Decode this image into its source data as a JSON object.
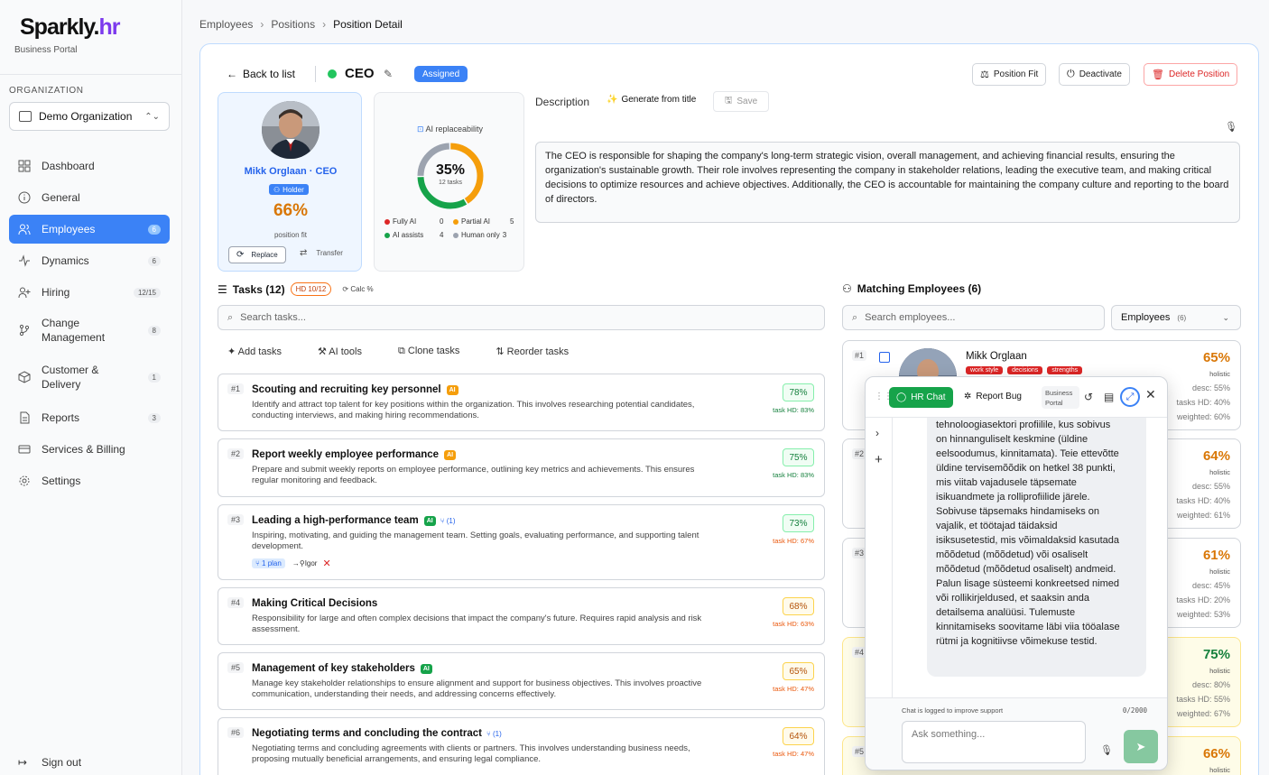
{
  "sidebar": {
    "logo_main": "Sparkly.",
    "logo_accent": "hr",
    "portal": "Business Portal",
    "org_label": "ORGANIZATION",
    "org_value": "Demo Organization",
    "items": [
      {
        "label": "Dashboard",
        "badge": "",
        "icon": "grid-icon"
      },
      {
        "label": "General",
        "badge": "",
        "icon": "info-icon"
      },
      {
        "label": "Employees",
        "badge": "6",
        "icon": "users-icon"
      },
      {
        "label": "Dynamics",
        "badge": "6",
        "icon": "activity-icon"
      },
      {
        "label": "Hiring",
        "badge": "12/15",
        "icon": "user-plus-icon"
      },
      {
        "label": "Change Management",
        "badge": "8",
        "icon": "git-branch-icon"
      },
      {
        "label": "Customer & Delivery",
        "badge": "1",
        "icon": "package-icon"
      },
      {
        "label": "Reports",
        "badge": "3",
        "icon": "document-icon"
      },
      {
        "label": "Services & Billing",
        "badge": "",
        "icon": "card-icon"
      },
      {
        "label": "Settings",
        "badge": "",
        "icon": "gear-icon"
      }
    ],
    "signout": "Sign out"
  },
  "breadcrumb": [
    "Employees",
    "Positions",
    "Position Detail"
  ],
  "header": {
    "back": "Back to list",
    "title": "CEO",
    "status": "Assigned",
    "btn_fit": "Position Fit",
    "btn_deactivate": "Deactivate",
    "btn_delete": "Delete Position"
  },
  "holder": {
    "name": "Mikk Orglaan · CEO",
    "badge": "Holder",
    "fit_pct": "66%",
    "fit_label": "position fit",
    "replace": "Replace",
    "transfer": "Transfer"
  },
  "ai": {
    "title": "AI replaceability",
    "pct": "35%",
    "tasks": "12 tasks",
    "fully_label": "Fully AI",
    "fully": "0",
    "partial_label": "Partial AI",
    "partial": "5",
    "assists_label": "AI assists",
    "assists": "4",
    "human_label": "Human only",
    "human": "3",
    "colors": {
      "fully": "#dc2626",
      "partial": "#f59e0b",
      "assists": "#16a34a",
      "human": "#9ca3af"
    }
  },
  "description": {
    "label": "Description",
    "generate": "Generate from title",
    "save": "Save",
    "text": "The CEO is responsible for shaping the company's long-term strategic vision, overall management, and achieving financial results, ensuring the organization's sustainable growth. Their role involves representing the company in stakeholder relations, leading the executive team, and making critical decisions to optimize resources and achieve objectives. Additionally, the CEO is accountable for maintaining the company culture and reporting to the board of directors."
  },
  "tasks": {
    "heading": "Tasks (12)",
    "hd_badge": "HD 10/12",
    "calc": "Calc %",
    "search_placeholder": "Search tasks...",
    "tools": [
      "Add tasks",
      "AI tools",
      "Clone tasks",
      "Reorder tasks"
    ],
    "items": [
      {
        "num": "#1",
        "title": "Scouting and recruiting key personnel",
        "ai": "AI",
        "desc": "Identify and attract top talent for key positions within the organization. This involves researching potential candidates, conducting interviews, and making hiring recommendations.",
        "score": "78%",
        "hd": "task HD: 83%"
      },
      {
        "num": "#2",
        "title": "Report weekly employee performance",
        "ai": "AI",
        "desc": "Prepare and submit weekly reports on employee performance, outlining key metrics and achievements. This ensures regular monitoring and feedback.",
        "score": "75%",
        "hd": "task HD: 83%"
      },
      {
        "num": "#3",
        "title": "Leading a high-performance team",
        "ai": "AI",
        "link": "(1)",
        "desc": "Inspiring, motivating, and guiding the management team. Setting goals, evaluating performance, and supporting talent development.",
        "score": "73%",
        "hd": "task HD: 67%",
        "plan": "1 plan",
        "assignee": "Igor"
      },
      {
        "num": "#4",
        "title": "Making Critical Decisions",
        "desc": "Responsibility for large and often complex decisions that impact the company's future. Requires rapid analysis and risk assessment.",
        "score": "68%",
        "hd": "task HD: 63%"
      },
      {
        "num": "#5",
        "title": "Management of key stakeholders",
        "ai": "AI",
        "desc": "Manage key stakeholder relationships to ensure alignment and support for business objectives. This involves proactive communication, understanding their needs, and addressing concerns effectively.",
        "score": "65%",
        "hd": "task HD: 47%"
      },
      {
        "num": "#6",
        "title": "Negotiating terms and concluding the contract",
        "link": "(1)",
        "desc": "Negotiating terms and concluding agreements with clients or partners. This involves understanding business needs, proposing mutually beneficial arrangements, and ensuring legal compliance.",
        "score": "64%",
        "hd": "task HD: 47%"
      }
    ]
  },
  "matching": {
    "heading": "Matching Employees (6)",
    "search_placeholder": "Search employees...",
    "filter": "Employees",
    "filter_count": "(6)",
    "cards": [
      {
        "num": "#1",
        "name": "Mikk Orglaan",
        "tags": [
          "work style",
          "decisions",
          "strengths"
        ],
        "pct": "65%",
        "color": "#d97706",
        "holistic": "holistic",
        "stats": [
          "desc: 55%",
          "tasks HD: 40%",
          "weighted: 60%"
        ]
      },
      {
        "num": "#2",
        "pct": "64%",
        "color": "#d97706",
        "holistic": "holistic",
        "stats": [
          "desc: 55%",
          "tasks HD: 40%",
          "weighted: 61%"
        ]
      },
      {
        "num": "#3",
        "pct": "61%",
        "color": "#d97706",
        "holistic": "holistic",
        "stats": [
          "desc: 45%",
          "tasks HD: 20%",
          "weighted: 53%"
        ]
      },
      {
        "num": "#4",
        "pct": "75%",
        "color": "#15803d",
        "holistic": "holistic",
        "stats": [
          "desc: 80%",
          "tasks HD: 55%",
          "weighted: 67%"
        ]
      },
      {
        "num": "#5",
        "pct": "66%",
        "color": "#d97706",
        "holistic": "holistic",
        "stats": []
      }
    ]
  },
  "chat": {
    "tab_chat": "HR Chat",
    "tab_bug": "Report Bug",
    "badge": "Business Portal",
    "message_lines": [
      "tehnoloogiasektori profiilile, kus sobivus",
      "on hinnanguliselt keskmine (üldine",
      "eelsoodumus, kinnitamata). Teie ettevõtte",
      "üldine tervisemõõdik on hetkel 38 punkti,",
      "mis viitab vajadusele täpsemate",
      "isikuandmete ja rolliprofiilide järele.",
      "Sobivuse täpsemaks hindamiseks on",
      "vajalik, et töötajad täidaksid",
      "isiksusetestid, mis võimaldaksid kasutada",
      "mõõdetud (mõõdetud) või osaliselt",
      "mõõdetud (mõõdetud osaliselt) andmeid.",
      "Palun lisage süsteemi konkreetsed nimed",
      "või rollikirjeldused, et saaksin anda",
      "detailsema analüüsi. Tulemuste",
      "kinnitamiseks soovitame läbi viia tööalase",
      "rütmi ja kognitiivse võimekuse testid."
    ],
    "logged": "Chat is logged to improve support",
    "count": "0/2000",
    "placeholder": "Ask something..."
  }
}
